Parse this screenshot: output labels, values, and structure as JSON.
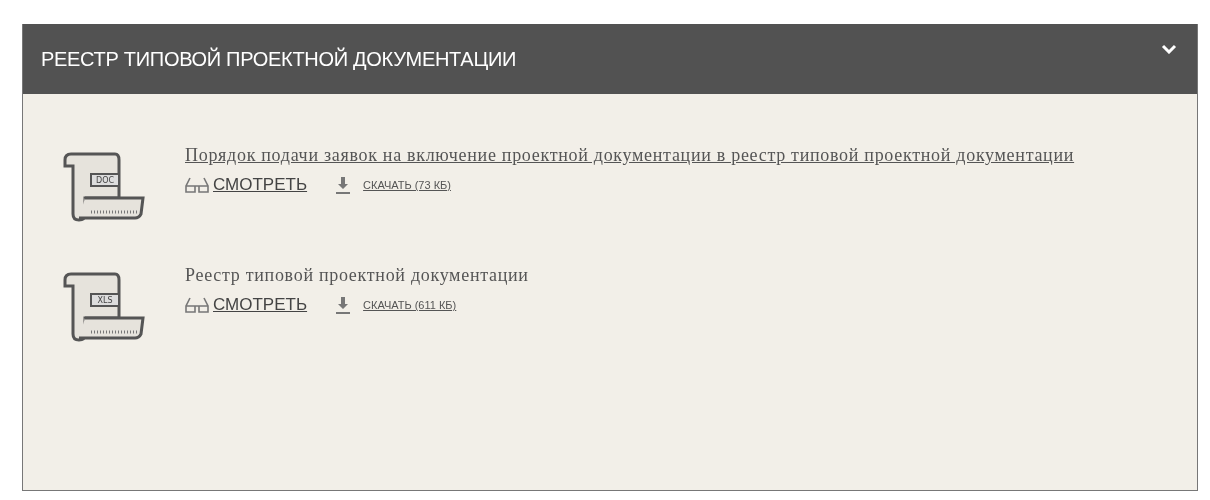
{
  "panel": {
    "title": "РЕЕСТР ТИПОВОЙ ПРОЕКТНОЙ ДОКУМЕНТАЦИИ",
    "expanded": true
  },
  "documents": [
    {
      "format": "DOC",
      "title": "Порядок подачи заявок на включение проектной документации в реестр типовой проектной документации",
      "linked": true,
      "view": "СМОТРЕТЬ",
      "download": "СКАЧАТЬ (73 КБ)"
    },
    {
      "format": "XLS",
      "title": "Реестр типовой проектной документации",
      "linked": false,
      "view": "СМОТРЕТЬ",
      "download": "СКАЧАТЬ (611 КБ)"
    }
  ]
}
